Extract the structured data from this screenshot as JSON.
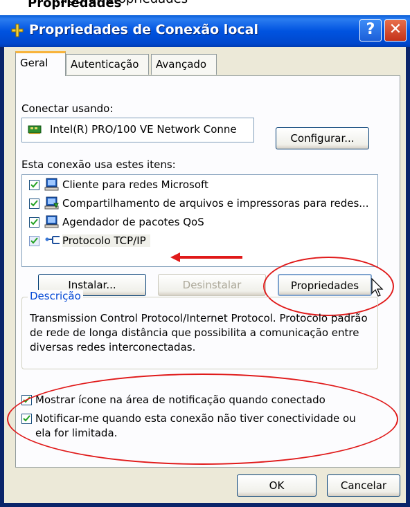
{
  "top_strip": {
    "text_normal": "…gurar propriedades",
    "text_bold": "Propriedades"
  },
  "window": {
    "title": "Propriedades de Conexão local",
    "help_label": "?",
    "close_label": "✕"
  },
  "tabs": [
    {
      "label": "Geral",
      "active": true
    },
    {
      "label": "Autenticação",
      "active": false
    },
    {
      "label": "Avançado",
      "active": false
    }
  ],
  "general": {
    "connect_using_label": "Conectar usando:",
    "adapter_name": "Intel(R) PRO/100 VE Network Conne",
    "configure_button": "Configurar...",
    "items_label": "Esta conexão usa estes itens:",
    "items": [
      {
        "label": "Cliente para redes Microsoft",
        "checked": true,
        "icon": "client-network-icon"
      },
      {
        "label": "Compartilhamento de arquivos e impressoras para redes...",
        "checked": true,
        "icon": "file-sharing-icon"
      },
      {
        "label": "Agendador de pacotes QoS",
        "checked": true,
        "icon": "qos-scheduler-icon"
      },
      {
        "label": "Protocolo TCP/IP",
        "checked": true,
        "icon": "protocol-icon",
        "selected": true
      }
    ],
    "install_button": "Instalar...",
    "uninstall_button": "Desinstalar",
    "properties_button": "Propriedades",
    "description_legend": "Descrição",
    "description_text": "Transmission Control Protocol/Internet Protocol. Protocolo padrão de rede de longa distância que possibilita a comunicação entre diversas redes interconectadas.",
    "option_show_icon": "Mostrar ícone na área de notificação quando conectado",
    "option_notify_line1": "Notificar-me quando esta conexão não tiver conectividade ou",
    "option_notify_line2": "ela for limitada.",
    "option_show_icon_checked": true,
    "option_notify_checked": true
  },
  "footer": {
    "ok_button": "OK",
    "cancel_button": "Cancelar"
  },
  "colors": {
    "annotation_red": "#e01a1a",
    "titlebar_blue": "#0053e0",
    "dialog_bg": "#ece9d8"
  }
}
